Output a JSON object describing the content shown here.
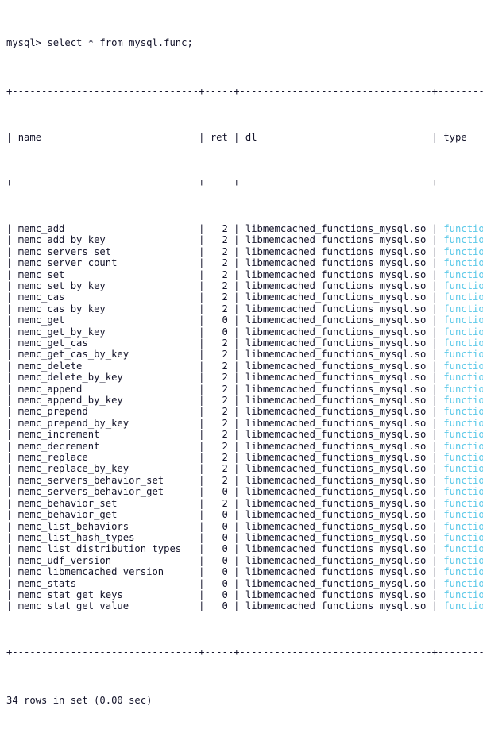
{
  "terminal": {
    "app": "mysql-client",
    "prompt": "mysql>",
    "command": "select * from mysql.func;",
    "prompt_line": "mysql> select * from mysql.func;",
    "footer": "34 rows in set (0.00 sec)",
    "row_count": 34,
    "elapsed": "0.00 sec",
    "colors": {
      "background": "#ffffff",
      "foreground": "#14142b",
      "type_value": "#59c8e8"
    },
    "box": {
      "corner": "+",
      "horizontal": "-",
      "vertical": "|",
      "rule": "+--------------------------------+-----+---------------------------------+----------+"
    }
  },
  "table": {
    "name": "mysql.func",
    "columns": [
      {
        "key": "name",
        "label": "name",
        "width": 30,
        "align": "left"
      },
      {
        "key": "ret",
        "label": "ret",
        "width": 3,
        "align": "right"
      },
      {
        "key": "dl",
        "label": "dl",
        "width": 31,
        "align": "left"
      },
      {
        "key": "type",
        "label": "type",
        "width": 8,
        "align": "left"
      }
    ],
    "rows": [
      {
        "name": "memc_add",
        "ret": "2",
        "dl": "libmemcached_functions_mysql.so",
        "type": "function"
      },
      {
        "name": "memc_add_by_key",
        "ret": "2",
        "dl": "libmemcached_functions_mysql.so",
        "type": "function"
      },
      {
        "name": "memc_servers_set",
        "ret": "2",
        "dl": "libmemcached_functions_mysql.so",
        "type": "function"
      },
      {
        "name": "memc_server_count",
        "ret": "2",
        "dl": "libmemcached_functions_mysql.so",
        "type": "function"
      },
      {
        "name": "memc_set",
        "ret": "2",
        "dl": "libmemcached_functions_mysql.so",
        "type": "function"
      },
      {
        "name": "memc_set_by_key",
        "ret": "2",
        "dl": "libmemcached_functions_mysql.so",
        "type": "function"
      },
      {
        "name": "memc_cas",
        "ret": "2",
        "dl": "libmemcached_functions_mysql.so",
        "type": "function"
      },
      {
        "name": "memc_cas_by_key",
        "ret": "2",
        "dl": "libmemcached_functions_mysql.so",
        "type": "function"
      },
      {
        "name": "memc_get",
        "ret": "0",
        "dl": "libmemcached_functions_mysql.so",
        "type": "function"
      },
      {
        "name": "memc_get_by_key",
        "ret": "0",
        "dl": "libmemcached_functions_mysql.so",
        "type": "function"
      },
      {
        "name": "memc_get_cas",
        "ret": "2",
        "dl": "libmemcached_functions_mysql.so",
        "type": "function"
      },
      {
        "name": "memc_get_cas_by_key",
        "ret": "2",
        "dl": "libmemcached_functions_mysql.so",
        "type": "function"
      },
      {
        "name": "memc_delete",
        "ret": "2",
        "dl": "libmemcached_functions_mysql.so",
        "type": "function"
      },
      {
        "name": "memc_delete_by_key",
        "ret": "2",
        "dl": "libmemcached_functions_mysql.so",
        "type": "function"
      },
      {
        "name": "memc_append",
        "ret": "2",
        "dl": "libmemcached_functions_mysql.so",
        "type": "function"
      },
      {
        "name": "memc_append_by_key",
        "ret": "2",
        "dl": "libmemcached_functions_mysql.so",
        "type": "function"
      },
      {
        "name": "memc_prepend",
        "ret": "2",
        "dl": "libmemcached_functions_mysql.so",
        "type": "function"
      },
      {
        "name": "memc_prepend_by_key",
        "ret": "2",
        "dl": "libmemcached_functions_mysql.so",
        "type": "function"
      },
      {
        "name": "memc_increment",
        "ret": "2",
        "dl": "libmemcached_functions_mysql.so",
        "type": "function"
      },
      {
        "name": "memc_decrement",
        "ret": "2",
        "dl": "libmemcached_functions_mysql.so",
        "type": "function"
      },
      {
        "name": "memc_replace",
        "ret": "2",
        "dl": "libmemcached_functions_mysql.so",
        "type": "function"
      },
      {
        "name": "memc_replace_by_key",
        "ret": "2",
        "dl": "libmemcached_functions_mysql.so",
        "type": "function"
      },
      {
        "name": "memc_servers_behavior_set",
        "ret": "2",
        "dl": "libmemcached_functions_mysql.so",
        "type": "function"
      },
      {
        "name": "memc_servers_behavior_get",
        "ret": "0",
        "dl": "libmemcached_functions_mysql.so",
        "type": "function"
      },
      {
        "name": "memc_behavior_set",
        "ret": "2",
        "dl": "libmemcached_functions_mysql.so",
        "type": "function"
      },
      {
        "name": "memc_behavior_get",
        "ret": "0",
        "dl": "libmemcached_functions_mysql.so",
        "type": "function"
      },
      {
        "name": "memc_list_behaviors",
        "ret": "0",
        "dl": "libmemcached_functions_mysql.so",
        "type": "function"
      },
      {
        "name": "memc_list_hash_types",
        "ret": "0",
        "dl": "libmemcached_functions_mysql.so",
        "type": "function"
      },
      {
        "name": "memc_list_distribution_types",
        "ret": "0",
        "dl": "libmemcached_functions_mysql.so",
        "type": "function"
      },
      {
        "name": "memc_udf_version",
        "ret": "0",
        "dl": "libmemcached_functions_mysql.so",
        "type": "function"
      },
      {
        "name": "memc_libmemcached_version",
        "ret": "0",
        "dl": "libmemcached_functions_mysql.so",
        "type": "function"
      },
      {
        "name": "memc_stats",
        "ret": "0",
        "dl": "libmemcached_functions_mysql.so",
        "type": "function"
      },
      {
        "name": "memc_stat_get_keys",
        "ret": "0",
        "dl": "libmemcached_functions_mysql.so",
        "type": "function"
      },
      {
        "name": "memc_stat_get_value",
        "ret": "0",
        "dl": "libmemcached_functions_mysql.so",
        "type": "function"
      }
    ]
  }
}
